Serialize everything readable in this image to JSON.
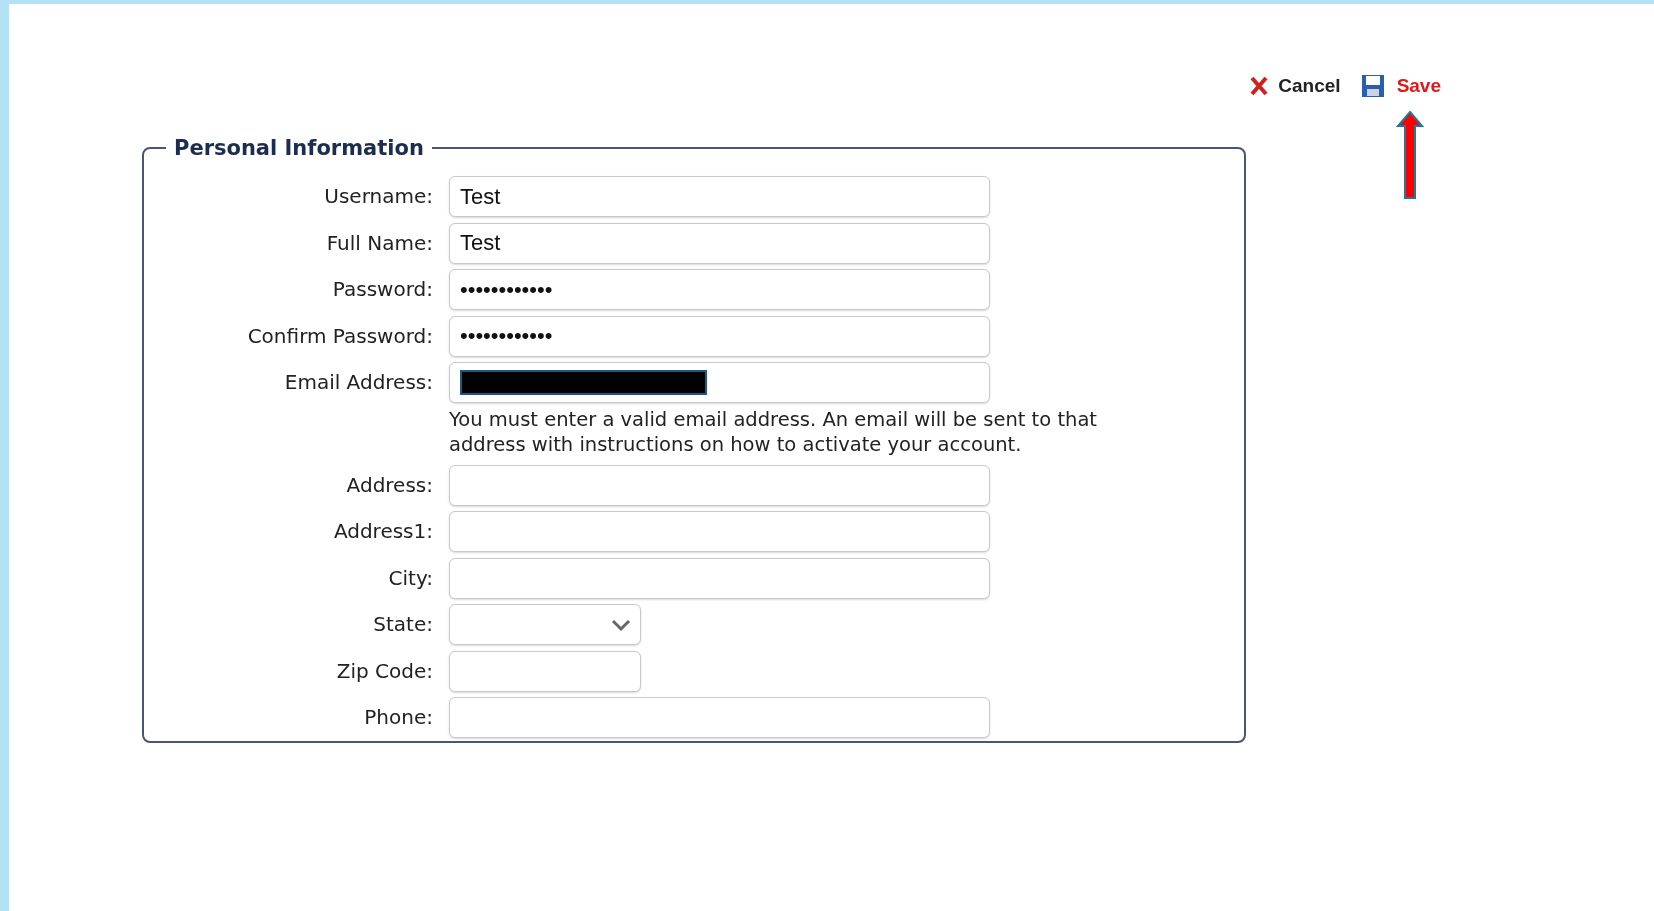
{
  "toolbar": {
    "cancel": "Cancel",
    "save": "Save"
  },
  "section": {
    "title": "Personal Information",
    "fields": [
      {
        "label": "Username:",
        "kind": "text",
        "value": "Test"
      },
      {
        "label": "Full Name:",
        "kind": "text",
        "value": "Test"
      },
      {
        "label": "Password:",
        "kind": "password",
        "value": "••••••••••••"
      },
      {
        "label": "Confirm Password:",
        "kind": "password",
        "value": "••••••••••••"
      },
      {
        "label": "Email Address:",
        "kind": "redacted",
        "help": "You must enter a valid email address. An email will be sent to that address with instructions on how to activate your account."
      },
      {
        "label": "Address:",
        "kind": "text"
      },
      {
        "label": "Address1:",
        "kind": "text"
      },
      {
        "label": "City:",
        "kind": "text"
      },
      {
        "label": "State:",
        "kind": "select"
      },
      {
        "label": "Zip Code:",
        "kind": "short"
      },
      {
        "label": "Phone:",
        "kind": "text"
      }
    ]
  }
}
